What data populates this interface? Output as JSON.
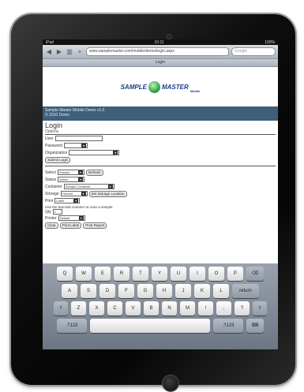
{
  "browser": {
    "status_left": "iPad",
    "status_time": "10:11",
    "status_right": "100%",
    "url": "www.samplemaster.com/mobile/demo/login.aspx",
    "search_placeholder": "Google",
    "page_title": "Login"
  },
  "site": {
    "logo_text_left": "SAMPLE",
    "logo_text_right": "MASTER",
    "logo_sub": "Mobile"
  },
  "banner": {
    "line1": "Sample Master Mobile Demo v1.0",
    "line2": "© 2010 Demo"
  },
  "heading": "Login",
  "section1": {
    "label": "Options",
    "user_label": "User",
    "password_label": "Password",
    "org_label": "Organization",
    "submit_button": "Submit Login"
  },
  "section2": {
    "field1_label": "Select",
    "field1_value": "Sample",
    "field1_button": "Refresh",
    "field2_label": "Status",
    "field2_value": "Active",
    "field3_label": "Container",
    "field3_value": "Sample Container",
    "field4_label": "Storage",
    "field4_value": "Freezer",
    "field4_button": "Set Storage Location",
    "field5_label": "Print",
    "field5_value": "Label",
    "note": "Use the barcode scanner to scan a sample",
    "count_label": "Qty",
    "count_value": "1",
    "printer_label": "Printer",
    "printer_value": "Default",
    "btn_a": "Clear",
    "btn_b": "Print Label",
    "btn_c": "Print Report"
  },
  "keyboard": {
    "row1": [
      "Q",
      "W",
      "E",
      "R",
      "T",
      "Y",
      "U",
      "I",
      "O",
      "P",
      "⌫"
    ],
    "row2": [
      "A",
      "S",
      "D",
      "F",
      "G",
      "H",
      "J",
      "K",
      "L",
      "return"
    ],
    "row3": [
      "⇧",
      "Z",
      "X",
      "C",
      "V",
      "B",
      "N",
      "M",
      "!",
      ",",
      "?",
      "⇧"
    ],
    "row4": [
      ".?123",
      "",
      ".?123",
      "⌨"
    ]
  }
}
